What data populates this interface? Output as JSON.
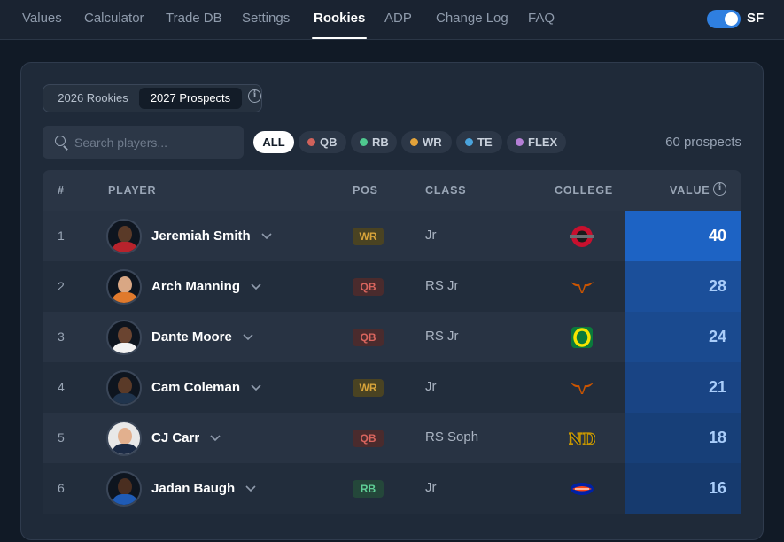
{
  "nav": {
    "items": [
      {
        "label": "Values"
      },
      {
        "label": "Calculator"
      },
      {
        "label": "Trade DB"
      },
      {
        "label": "Settings"
      },
      {
        "label": "Rookies"
      },
      {
        "label": "ADP"
      },
      {
        "label": "Change Log"
      },
      {
        "label": "FAQ"
      }
    ],
    "active": "Rookies",
    "toggle_label": "SF",
    "toggle_on": true
  },
  "tabs": {
    "rookies_label": "2026 Rookies",
    "prospects_label": "2027 Prospects",
    "selected": "2027 Prospects"
  },
  "search": {
    "placeholder": "Search players..."
  },
  "filters": {
    "all_label": "ALL",
    "chips": [
      {
        "label": "QB",
        "color": "#d0625b"
      },
      {
        "label": "RB",
        "color": "#4fc98f"
      },
      {
        "label": "WR",
        "color": "#e3a33a"
      },
      {
        "label": "TE",
        "color": "#4aa3dc"
      },
      {
        "label": "FLEX",
        "color": "#b57fd6"
      }
    ]
  },
  "count_text": "60 prospects",
  "table": {
    "headers": {
      "rank": "#",
      "player": "PLAYER",
      "pos": "POS",
      "class": "CLASS",
      "college": "COLLEGE",
      "value": "VALUE"
    },
    "rows": [
      {
        "rank": "1",
        "name": "Jeremiah Smith",
        "pos": "WR",
        "class": "Jr",
        "college": "Ohio State",
        "value": "40"
      },
      {
        "rank": "2",
        "name": "Arch Manning",
        "pos": "QB",
        "class": "RS Jr",
        "college": "Texas",
        "value": "28"
      },
      {
        "rank": "3",
        "name": "Dante Moore",
        "pos": "QB",
        "class": "RS Jr",
        "college": "Oregon",
        "value": "24"
      },
      {
        "rank": "4",
        "name": "Cam Coleman",
        "pos": "WR",
        "class": "Jr",
        "college": "Texas",
        "value": "21"
      },
      {
        "rank": "5",
        "name": "CJ Carr",
        "pos": "QB",
        "class": "RS Soph",
        "college": "Notre Dame",
        "value": "18"
      },
      {
        "rank": "6",
        "name": "Jadan Baugh",
        "pos": "RB",
        "class": "Jr",
        "college": "Florida",
        "value": "16"
      }
    ]
  },
  "colors": {
    "accent": "#2f7fe0",
    "value_top": "#1d63c4",
    "pos_wr_bg": "#4a4322",
    "pos_wr_fg": "#d8a43a",
    "pos_qb_bg": "#4a2b2d",
    "pos_qb_fg": "#d9655e",
    "pos_rb_bg": "#24473a",
    "pos_rb_fg": "#5fcf96"
  }
}
